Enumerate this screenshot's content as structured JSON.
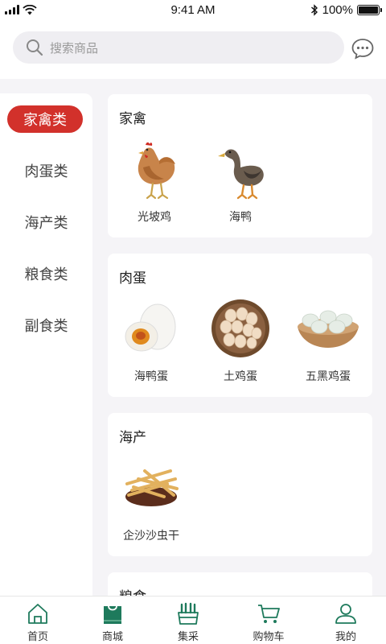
{
  "status_bar": {
    "time": "9:41 AM",
    "battery": "100%",
    "battery_level": 1.0
  },
  "search": {
    "placeholder": "搜索商品"
  },
  "colors": {
    "accent": "#d2312b",
    "brand_green": "#1e7a5c",
    "page_bg": "#f5f4f7"
  },
  "sidebar": {
    "active_index": 0,
    "items": [
      {
        "label": "家禽类"
      },
      {
        "label": "肉蛋类"
      },
      {
        "label": "海产类"
      },
      {
        "label": "粮食类"
      },
      {
        "label": "副食类"
      }
    ]
  },
  "sections": [
    {
      "title": "家禽",
      "products": [
        {
          "name": "光坡鸡",
          "icon": "chicken-image"
        },
        {
          "name": "海鸭",
          "icon": "duck-image"
        }
      ]
    },
    {
      "title": "肉蛋",
      "products": [
        {
          "name": "海鸭蛋",
          "icon": "salted-egg-image"
        },
        {
          "name": "土鸡蛋",
          "icon": "egg-basket-image"
        },
        {
          "name": "五黑鸡蛋",
          "icon": "egg-bowl-image"
        }
      ]
    },
    {
      "title": "海产",
      "products": [
        {
          "name": "企沙沙虫干",
          "icon": "dried-worm-image"
        }
      ]
    },
    {
      "title": "粮食",
      "products": []
    }
  ],
  "tabbar": {
    "items": [
      {
        "label": "首页",
        "icon": "home-icon"
      },
      {
        "label": "商城",
        "icon": "shopping-bag-icon"
      },
      {
        "label": "集采",
        "icon": "basket-icon"
      },
      {
        "label": "购物车",
        "icon": "cart-icon"
      },
      {
        "label": "我的",
        "icon": "user-icon"
      }
    ]
  }
}
